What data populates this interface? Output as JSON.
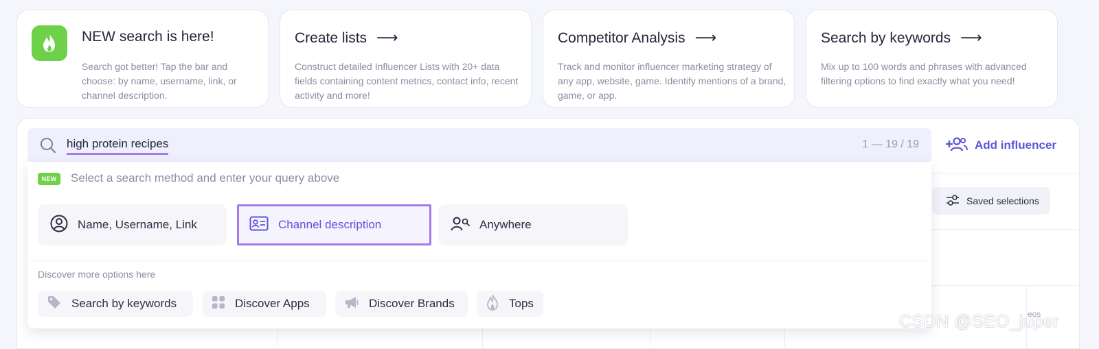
{
  "cards": [
    {
      "title": "NEW search is here!",
      "desc": "Search got better! Tap the bar and choose: by name, username, link, or channel description.",
      "icon": "flame-icon",
      "has_arrow": false
    },
    {
      "title": "Create lists",
      "desc": "Construct detailed Influencer Lists with 20+ data fields containing content metrics, contact info, recent activity and more!",
      "has_arrow": true
    },
    {
      "title": "Competitor Analysis",
      "desc": "Track and monitor influencer marketing strategy of any app, website, game. Identify mentions of a brand, game, or app.",
      "has_arrow": true
    },
    {
      "title": "Search by keywords",
      "desc": "Mix up to 100 words and phrases with advanced filtering options to find exactly what you need!",
      "has_arrow": true
    }
  ],
  "arrow_glyph": "⟶",
  "search": {
    "query": "high protein recipes",
    "count": "1 — 19 / 19",
    "icon": "search-icon"
  },
  "add_influencer": {
    "label": "Add influencer",
    "icon": "add-user-icon"
  },
  "saved_selections": {
    "label": "Saved selections",
    "icon": "sliders-icon"
  },
  "dropdown": {
    "badge": "NEW",
    "hint": "Select a search method and enter your query above",
    "methods": [
      {
        "label": "Name, Username, Link",
        "icon": "user-circle-icon",
        "selected": false
      },
      {
        "label": "Channel description",
        "icon": "id-card-icon",
        "selected": true
      },
      {
        "label": "Anywhere",
        "icon": "user-search-icon",
        "selected": false
      }
    ],
    "more_label": "Discover more options here",
    "quick_links": [
      {
        "label": "Search by keywords",
        "icon": "tag-icon"
      },
      {
        "label": "Discover Apps",
        "icon": "grid-icon"
      },
      {
        "label": "Discover Brands",
        "icon": "megaphone-icon"
      },
      {
        "label": "Tops",
        "icon": "flame-icon"
      }
    ]
  },
  "background_peek": "eos",
  "watermark": "CSDN @SEO_juper",
  "colors": {
    "accent": "#5c55d8",
    "highlight": "#a47be6",
    "green": "#6fd04a"
  }
}
